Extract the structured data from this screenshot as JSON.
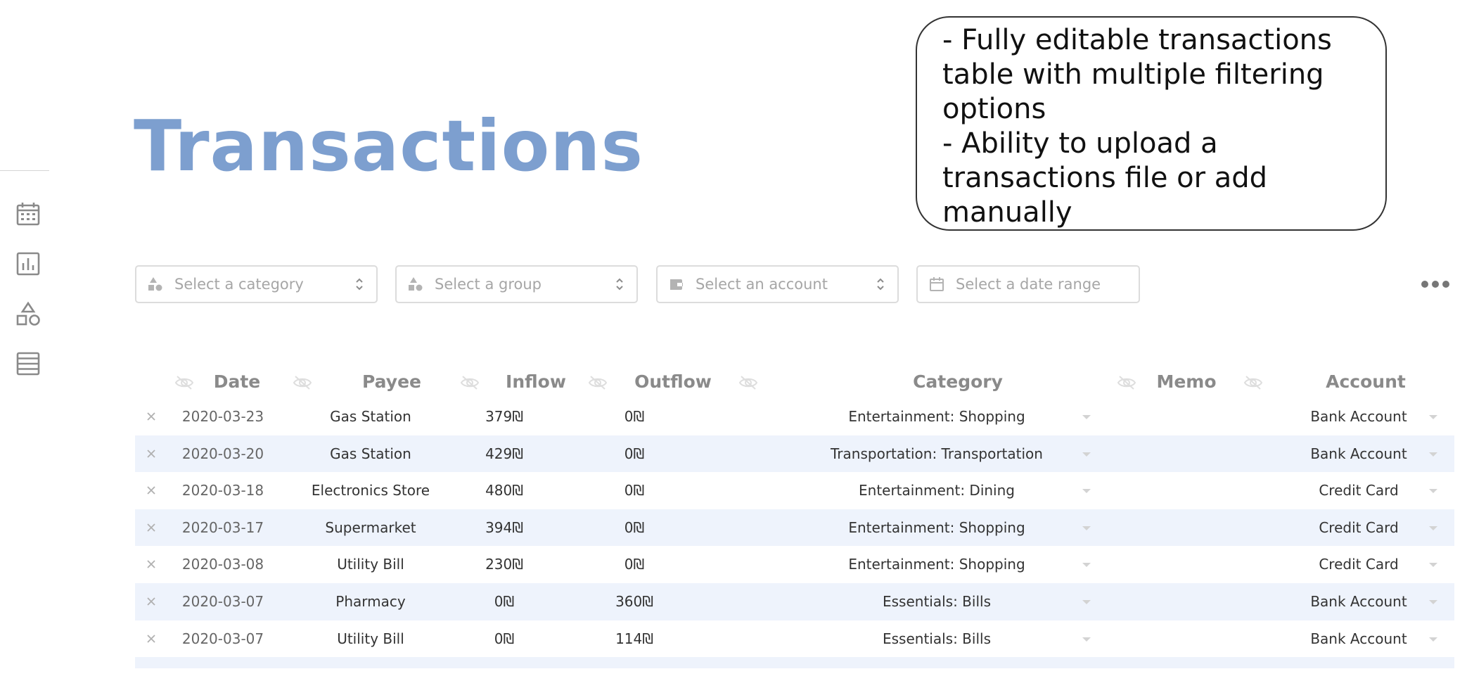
{
  "page": {
    "title": "Transactions",
    "colors": {
      "title": "#7d9fcf",
      "row_stripe": "#eef3fc",
      "icon": "#8a8a8a"
    }
  },
  "sidebar": {
    "icons": [
      "calendar-icon",
      "bar-chart-icon",
      "shapes-icon",
      "list-icon"
    ]
  },
  "callout": {
    "lines": [
      "- Fully editable transactions",
      "table with multiple filtering",
      "options",
      "- Ability to upload a",
      "transactions file or add",
      "manually"
    ]
  },
  "filters": {
    "category": {
      "placeholder": "Select a category",
      "icon": "shapes-icon"
    },
    "group": {
      "placeholder": "Select a group",
      "icon": "shapes-icon"
    },
    "account": {
      "placeholder": "Select an account",
      "icon": "wallet-icon"
    },
    "date_range": {
      "placeholder": "Select a date range",
      "icon": "calendar-icon"
    }
  },
  "table": {
    "headers": {
      "date": "Date",
      "payee": "Payee",
      "inflow": "Inflow",
      "outflow": "Outflow",
      "category": "Category",
      "memo": "Memo",
      "account": "Account"
    },
    "rows": [
      {
        "date": "2020-03-23",
        "payee": "Gas Station",
        "inflow": "379₪",
        "outflow": "0₪",
        "category": "Entertainment: Shopping",
        "memo": "",
        "account": "Bank Account"
      },
      {
        "date": "2020-03-20",
        "payee": "Gas Station",
        "inflow": "429₪",
        "outflow": "0₪",
        "category": "Transportation: Transportation",
        "memo": "",
        "account": "Bank Account"
      },
      {
        "date": "2020-03-18",
        "payee": "Electronics Store",
        "inflow": "480₪",
        "outflow": "0₪",
        "category": "Entertainment: Dining",
        "memo": "",
        "account": "Credit Card"
      },
      {
        "date": "2020-03-17",
        "payee": "Supermarket",
        "inflow": "394₪",
        "outflow": "0₪",
        "category": "Entertainment: Shopping",
        "memo": "",
        "account": "Credit Card"
      },
      {
        "date": "2020-03-08",
        "payee": "Utility Bill",
        "inflow": "230₪",
        "outflow": "0₪",
        "category": "Entertainment: Shopping",
        "memo": "",
        "account": "Credit Card"
      },
      {
        "date": "2020-03-07",
        "payee": "Pharmacy",
        "inflow": "0₪",
        "outflow": "360₪",
        "category": "Essentials: Bills",
        "memo": "",
        "account": "Bank Account"
      },
      {
        "date": "2020-03-07",
        "payee": "Utility Bill",
        "inflow": "0₪",
        "outflow": "114₪",
        "category": "Essentials: Bills",
        "memo": "",
        "account": "Bank Account"
      }
    ]
  }
}
